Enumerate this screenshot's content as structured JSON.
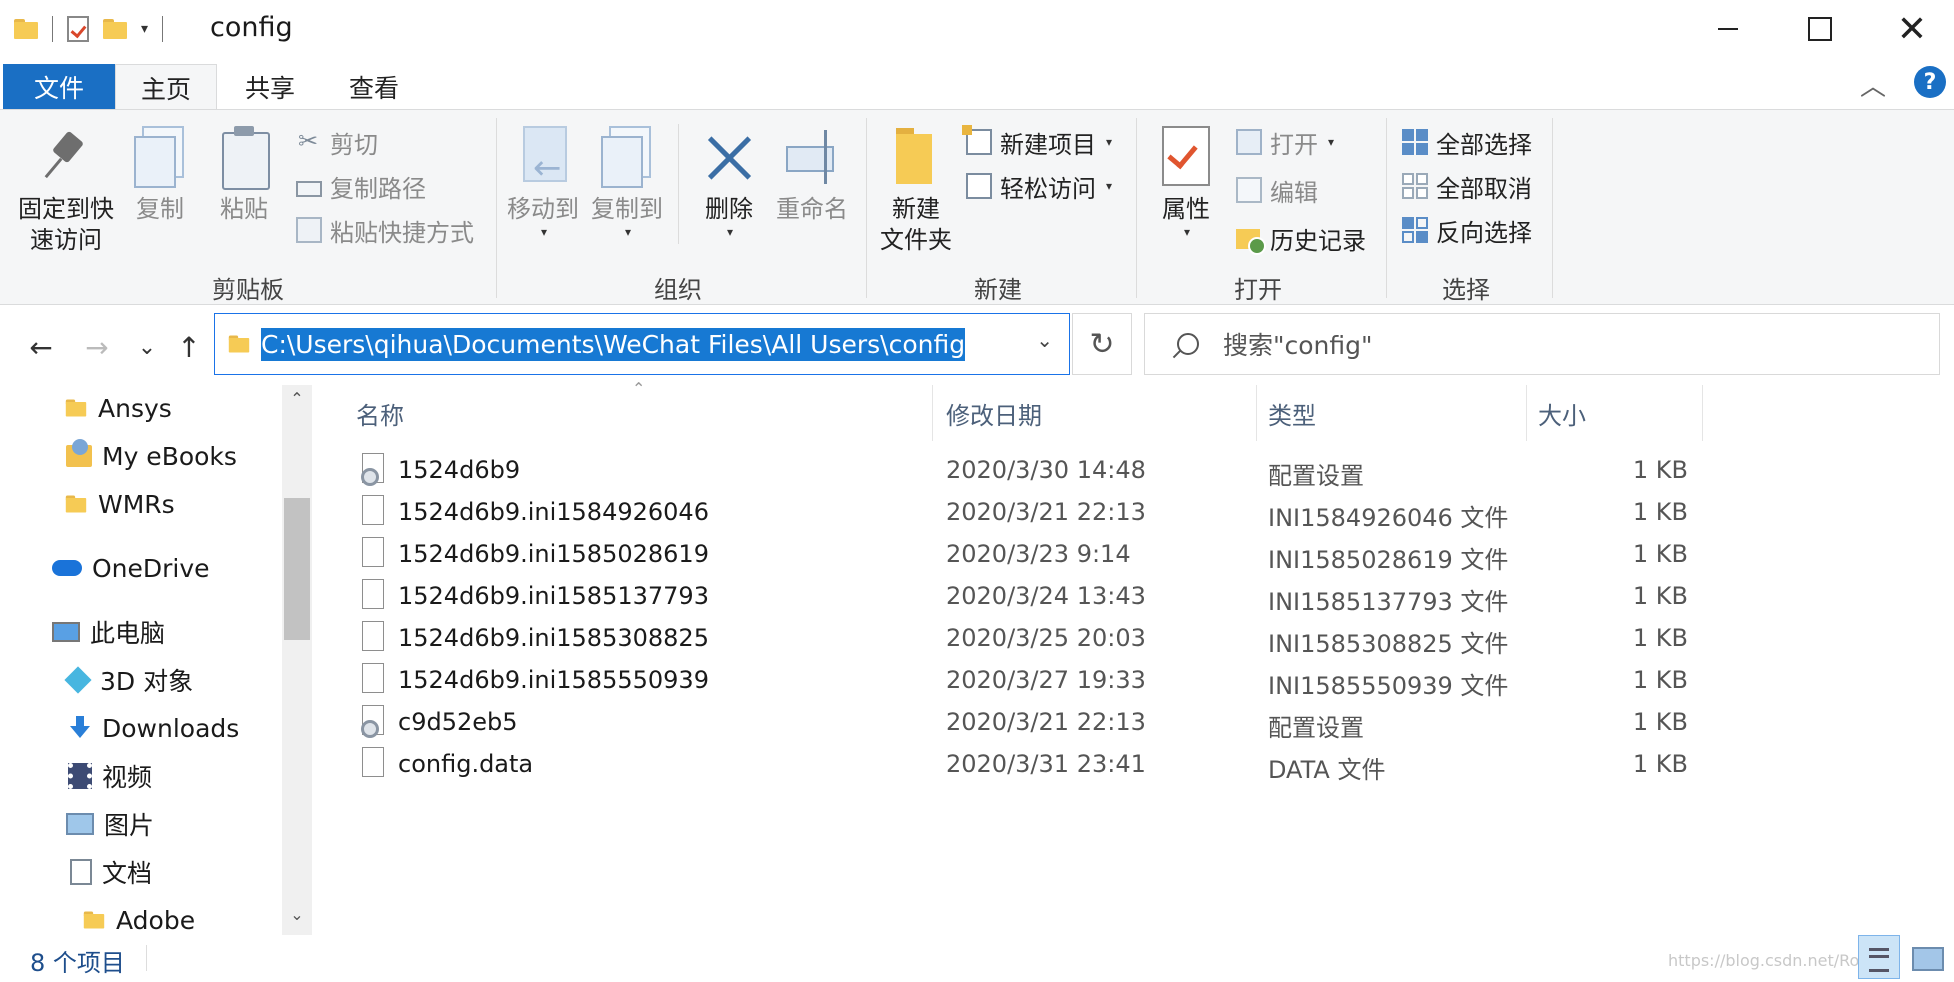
{
  "window": {
    "title": "config",
    "minimize": "",
    "maximize": "",
    "close": "✕"
  },
  "qat": {
    "dropdown": "▾"
  },
  "ribbon_tabs": [
    {
      "label": "文件"
    },
    {
      "label": "主页"
    },
    {
      "label": "共享"
    },
    {
      "label": "查看"
    }
  ],
  "ribbon_controls": {
    "collapse": "︿",
    "help": "?"
  },
  "ribbon": {
    "clipboard": {
      "group_label": "剪贴板",
      "pin": "固定到快\n速访问",
      "copy": "复制",
      "paste": "粘贴",
      "cut": "剪切",
      "copy_path": "复制路径",
      "paste_shortcut": "粘贴快捷方式"
    },
    "organize": {
      "group_label": "组织",
      "move_to": "移动到",
      "copy_to": "复制到",
      "delete": "删除",
      "rename": "重命名"
    },
    "new": {
      "group_label": "新建",
      "new_folder": "新建\n文件夹",
      "new_item": "新建项目",
      "easy_access": "轻松访问"
    },
    "open": {
      "group_label": "打开",
      "properties": "属性",
      "open": "打开",
      "edit": "编辑",
      "history": "历史记录"
    },
    "select": {
      "group_label": "选择",
      "select_all": "全部选择",
      "select_none": "全部取消",
      "invert": "反向选择"
    }
  },
  "nav": {
    "back": "←",
    "forward": "→",
    "recent": "⌄",
    "up": "↑"
  },
  "address": {
    "path": "C:\\Users\\qihua\\Documents\\WeChat Files\\All Users\\config",
    "dropdown": "⌄",
    "refresh": "↻"
  },
  "search": {
    "placeholder": "搜索\"config\""
  },
  "navpane": {
    "items": [
      {
        "label": "Ansys",
        "icon": "folder-icon"
      },
      {
        "label": "My eBooks",
        "icon": "ebook-folder-icon"
      },
      {
        "label": "WMRs",
        "icon": "folder-icon"
      },
      {
        "label": "OneDrive",
        "icon": "onedrive-icon"
      },
      {
        "label": "此电脑",
        "icon": "this-pc-icon"
      },
      {
        "label": "3D 对象",
        "icon": "3d-objects-icon"
      },
      {
        "label": "Downloads",
        "icon": "downloads-icon"
      },
      {
        "label": "视频",
        "icon": "videos-icon"
      },
      {
        "label": "图片",
        "icon": "pictures-icon"
      },
      {
        "label": "文档",
        "icon": "documents-icon"
      },
      {
        "label": "Adobe",
        "icon": "folder-icon"
      }
    ],
    "scroll_up": "⌃",
    "scroll_down": "⌄"
  },
  "filelist": {
    "columns": {
      "name": "名称",
      "date": "修改日期",
      "type": "类型",
      "size": "大小"
    },
    "sort_indicator": "⌃",
    "rows": [
      {
        "name": "1524d6b9",
        "date": "2020/3/30 14:48",
        "type": "配置设置",
        "size": "1 KB",
        "icon": "config-file-icon"
      },
      {
        "name": "1524d6b9.ini1584926046",
        "date": "2020/3/21 22:13",
        "type": "INI1584926046 文件",
        "size": "1 KB",
        "icon": "file-icon"
      },
      {
        "name": "1524d6b9.ini1585028619",
        "date": "2020/3/23 9:14",
        "type": "INI1585028619 文件",
        "size": "1 KB",
        "icon": "file-icon"
      },
      {
        "name": "1524d6b9.ini1585137793",
        "date": "2020/3/24 13:43",
        "type": "INI1585137793 文件",
        "size": "1 KB",
        "icon": "file-icon"
      },
      {
        "name": "1524d6b9.ini1585308825",
        "date": "2020/3/25 20:03",
        "type": "INI1585308825 文件",
        "size": "1 KB",
        "icon": "file-icon"
      },
      {
        "name": "1524d6b9.ini1585550939",
        "date": "2020/3/27 19:33",
        "type": "INI1585550939 文件",
        "size": "1 KB",
        "icon": "file-icon"
      },
      {
        "name": "c9d52eb5",
        "date": "2020/3/21 22:13",
        "type": "配置设置",
        "size": "1 KB",
        "icon": "config-file-icon"
      },
      {
        "name": "config.data",
        "date": "2020/3/31 23:41",
        "type": "DATA 文件",
        "size": "1 KB",
        "icon": "file-icon"
      }
    ]
  },
  "status": {
    "count": "8 个项目",
    "watermark": "https://blog.csdn.net/Robo..."
  },
  "colors": {
    "accent": "#1a6fc4",
    "selection": "#1779d3",
    "folder": "#f6cb55"
  }
}
